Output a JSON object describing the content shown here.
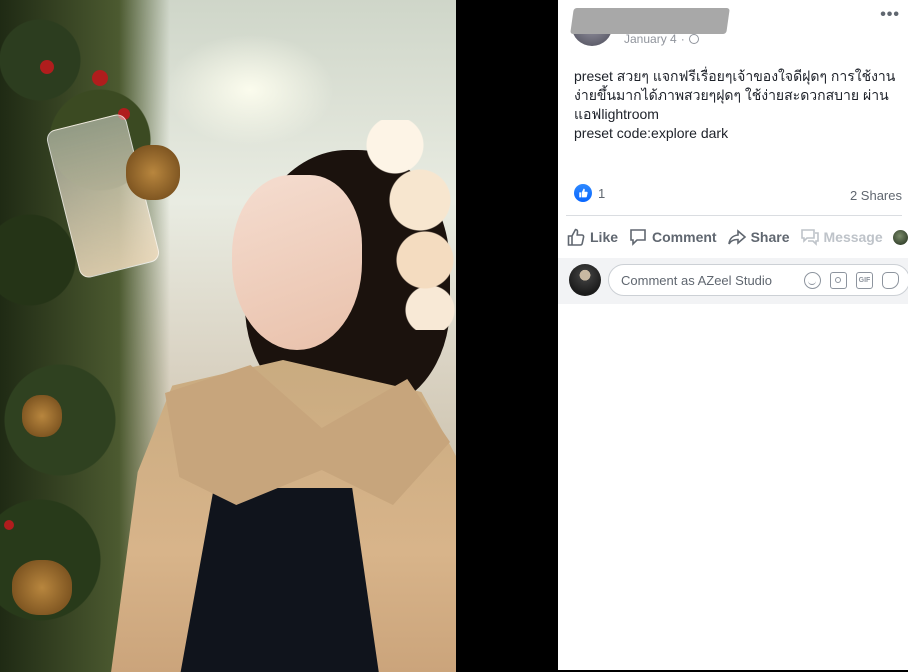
{
  "post": {
    "date": "January 4",
    "text_lines": [
      "preset สวยๆ แจกฟรีเรื่อยๆเจ้าของใจดีฝุดๆ การใช้งาน",
      "ง่ายขึ้นมากได้ภาพสวยๆฝุดๆ ใช้ง่ายสะดวกสบาย ผ่าน",
      "แอฟlightroom",
      "preset code:explore dark"
    ],
    "reaction_count": "1",
    "shares": "2 Shares"
  },
  "actions": {
    "like": "Like",
    "comment": "Comment",
    "share": "Share",
    "message": "Message"
  },
  "comment_input": {
    "placeholder": "Comment as AZeel Studio"
  },
  "icons": [
    "more-icon",
    "globe-icon",
    "like-reaction-icon",
    "thumbs-up-icon",
    "comment-icon",
    "share-icon",
    "message-icon",
    "emoji-icon",
    "camera-icon",
    "gif-icon",
    "sticker-icon"
  ],
  "colors": {
    "accent": "#1877f2",
    "text": "#1d2129",
    "muted": "#606770",
    "backdrop": "#000000"
  }
}
